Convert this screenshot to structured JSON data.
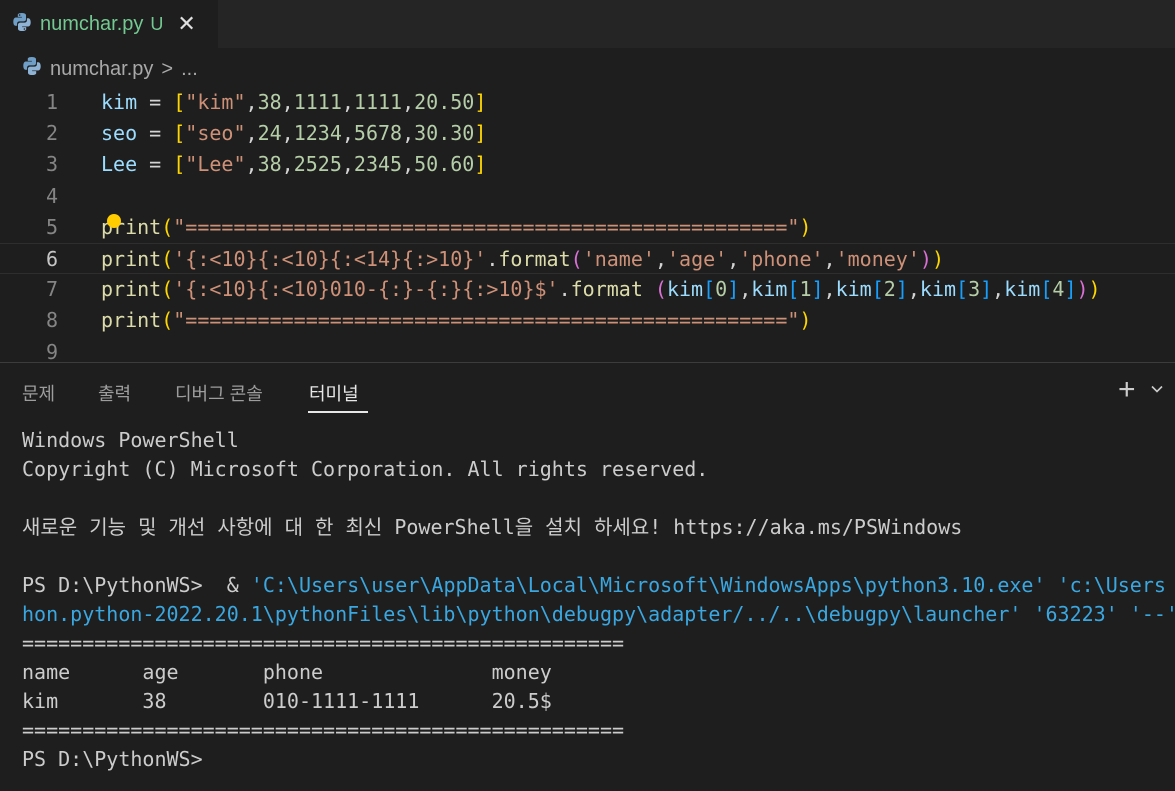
{
  "tab": {
    "filename": "numchar.py",
    "status": "U",
    "close": "✕"
  },
  "breadcrumb": {
    "file": "numchar.py",
    "sep": ">",
    "more": "..."
  },
  "editor": {
    "lines": [
      {
        "n": "1",
        "tokens": [
          [
            "kim",
            "#9cdcfe"
          ],
          [
            " = ",
            "#d4d4d4"
          ],
          [
            "[",
            "#ffd700"
          ],
          [
            "\"kim\"",
            "#ce9178"
          ],
          [
            ",",
            "#d4d4d4"
          ],
          [
            "38",
            "#b5cea8"
          ],
          [
            ",",
            "#d4d4d4"
          ],
          [
            "1111",
            "#b5cea8"
          ],
          [
            ",",
            "#d4d4d4"
          ],
          [
            "1111",
            "#b5cea8"
          ],
          [
            ",",
            "#d4d4d4"
          ],
          [
            "20.50",
            "#b5cea8"
          ],
          [
            "]",
            "#ffd700"
          ]
        ]
      },
      {
        "n": "2",
        "tokens": [
          [
            "seo",
            "#9cdcfe"
          ],
          [
            " = ",
            "#d4d4d4"
          ],
          [
            "[",
            "#ffd700"
          ],
          [
            "\"seo\"",
            "#ce9178"
          ],
          [
            ",",
            "#d4d4d4"
          ],
          [
            "24",
            "#b5cea8"
          ],
          [
            ",",
            "#d4d4d4"
          ],
          [
            "1234",
            "#b5cea8"
          ],
          [
            ",",
            "#d4d4d4"
          ],
          [
            "5678",
            "#b5cea8"
          ],
          [
            ",",
            "#d4d4d4"
          ],
          [
            "30.30",
            "#b5cea8"
          ],
          [
            "]",
            "#ffd700"
          ]
        ]
      },
      {
        "n": "3",
        "tokens": [
          [
            "Lee",
            "#9cdcfe"
          ],
          [
            " = ",
            "#d4d4d4"
          ],
          [
            "[",
            "#ffd700"
          ],
          [
            "\"Lee\"",
            "#ce9178"
          ],
          [
            ",",
            "#d4d4d4"
          ],
          [
            "38",
            "#b5cea8"
          ],
          [
            ",",
            "#d4d4d4"
          ],
          [
            "2525",
            "#b5cea8"
          ],
          [
            ",",
            "#d4d4d4"
          ],
          [
            "2345",
            "#b5cea8"
          ],
          [
            ",",
            "#d4d4d4"
          ],
          [
            "50.60",
            "#b5cea8"
          ],
          [
            "]",
            "#ffd700"
          ]
        ]
      },
      {
        "n": "4",
        "tokens": []
      },
      {
        "n": "5",
        "tokens": [
          [
            "print",
            "#dcdcaa"
          ],
          [
            "(",
            "#ffd700"
          ],
          [
            "\"==================================================\"",
            "#ce9178"
          ],
          [
            ")",
            "#ffd700"
          ]
        ]
      },
      {
        "n": "6",
        "active": true,
        "tokens": [
          [
            "print",
            "#dcdcaa"
          ],
          [
            "(",
            "#ffd700"
          ],
          [
            "'{:<10}{:<10}{:<14}{:>10}'",
            "#ce9178"
          ],
          [
            ".",
            "#d4d4d4"
          ],
          [
            "format",
            "#dcdcaa"
          ],
          [
            "(",
            "#da70d6"
          ],
          [
            "'name'",
            "#ce9178"
          ],
          [
            ",",
            "#d4d4d4"
          ],
          [
            "'age'",
            "#ce9178"
          ],
          [
            ",",
            "#d4d4d4"
          ],
          [
            "'phone'",
            "#ce9178"
          ],
          [
            ",",
            "#d4d4d4"
          ],
          [
            "'money'",
            "#ce9178"
          ],
          [
            ")",
            "#da70d6"
          ],
          [
            ")",
            "#ffd700"
          ]
        ]
      },
      {
        "n": "7",
        "tokens": [
          [
            "print",
            "#dcdcaa"
          ],
          [
            "(",
            "#ffd700"
          ],
          [
            "'{:<10}{:<10}010-{:}-{:}{:>10}$'",
            "#ce9178"
          ],
          [
            ".",
            "#d4d4d4"
          ],
          [
            "format ",
            "#dcdcaa"
          ],
          [
            "(",
            "#da70d6"
          ],
          [
            "kim",
            "#9cdcfe"
          ],
          [
            "[",
            "#179fff"
          ],
          [
            "0",
            "#b5cea8"
          ],
          [
            "]",
            "#179fff"
          ],
          [
            ",",
            "#d4d4d4"
          ],
          [
            "kim",
            "#9cdcfe"
          ],
          [
            "[",
            "#179fff"
          ],
          [
            "1",
            "#b5cea8"
          ],
          [
            "]",
            "#179fff"
          ],
          [
            ",",
            "#d4d4d4"
          ],
          [
            "kim",
            "#9cdcfe"
          ],
          [
            "[",
            "#179fff"
          ],
          [
            "2",
            "#b5cea8"
          ],
          [
            "]",
            "#179fff"
          ],
          [
            ",",
            "#d4d4d4"
          ],
          [
            "kim",
            "#9cdcfe"
          ],
          [
            "[",
            "#179fff"
          ],
          [
            "3",
            "#b5cea8"
          ],
          [
            "]",
            "#179fff"
          ],
          [
            ",",
            "#d4d4d4"
          ],
          [
            "kim",
            "#9cdcfe"
          ],
          [
            "[",
            "#179fff"
          ],
          [
            "4",
            "#b5cea8"
          ],
          [
            "]",
            "#179fff"
          ],
          [
            ")",
            "#da70d6"
          ],
          [
            ")",
            "#ffd700"
          ]
        ]
      },
      {
        "n": "8",
        "tokens": [
          [
            "print",
            "#dcdcaa"
          ],
          [
            "(",
            "#ffd700"
          ],
          [
            "\"==================================================\"",
            "#ce9178"
          ],
          [
            ")",
            "#ffd700"
          ]
        ]
      },
      {
        "n": "9",
        "tokens": []
      }
    ]
  },
  "panel": {
    "tabs": [
      {
        "label": "문제",
        "active": false
      },
      {
        "label": "출력",
        "active": false
      },
      {
        "label": "디버그 콘솔",
        "active": false
      },
      {
        "label": "터미널",
        "active": true
      }
    ],
    "add": "+",
    "icons": {
      "add": "plus-icon",
      "dropdown": "chevron-down-icon",
      "file": "python-icon"
    }
  },
  "terminal": {
    "line1": "Windows PowerShell",
    "line2": "Copyright (C) Microsoft Corporation. All rights reserved.",
    "line3": "",
    "line4": "새로운 기능 및 개선 사항에 대 한 최신 PowerShell을 설치 하세요! https://aka.ms/PSWindows",
    "line5": "",
    "prompt1": "PS D:\\PythonWS>  & ",
    "cmd1": "'C:\\Users\\user\\AppData\\Local\\Microsoft\\WindowsApps\\python3.10.exe' 'c:\\Users",
    "cmd2": "hon.python-2022.20.1\\pythonFiles\\lib\\python\\debugpy\\adapter/../..\\debugpy\\launcher' '63223' '--'",
    "sep1": "==================================================",
    "header": "name      age       phone              money",
    "row": "kim       38        010-1111-1111      20.5$",
    "sep2": "==================================================",
    "prompt2": "PS D:\\PythonWS>"
  },
  "colors": {
    "accent": "#73c991",
    "bg": "#1e1e1e",
    "tabbar": "#252526",
    "terminal_cmd": "#3aa7e0"
  }
}
